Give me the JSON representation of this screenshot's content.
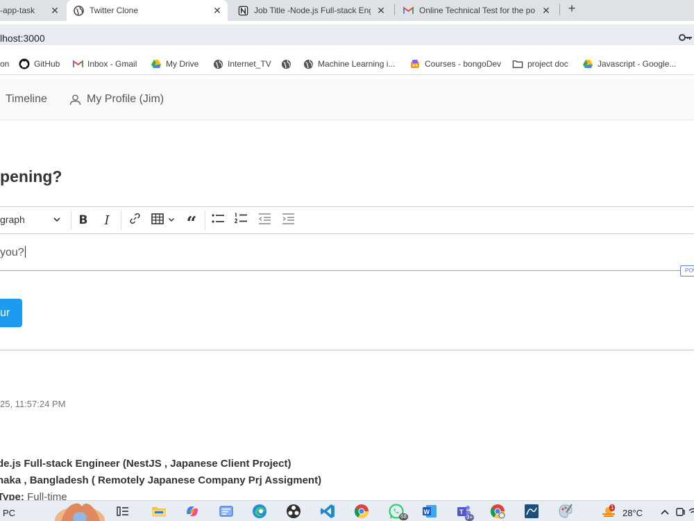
{
  "browser": {
    "tabs": [
      {
        "title": "-app-task",
        "active": false
      },
      {
        "title": "Twitter Clone",
        "active": true
      },
      {
        "title": "Job Title -Node.js Full-stack Eng",
        "active": false
      },
      {
        "title": "Online Technical Test for the po",
        "active": false
      }
    ],
    "url": "lhost:3000"
  },
  "bookmarks": [
    {
      "label": "on",
      "icon": "none"
    },
    {
      "label": "GitHub",
      "icon": "github-icon"
    },
    {
      "label": "Inbox - Gmail",
      "icon": "gmail-icon"
    },
    {
      "label": "My Drive",
      "icon": "drive-icon"
    },
    {
      "label": "Internet_TV",
      "icon": "globe-icon"
    },
    {
      "label": "",
      "icon": "globe-icon"
    },
    {
      "label": "Machine Learning i...",
      "icon": "globe-icon"
    },
    {
      "label": "Courses - bongoDev",
      "icon": "bongodev-icon"
    },
    {
      "label": "project doc",
      "icon": "folder-icon"
    },
    {
      "label": "Javascript - Google...",
      "icon": "drive-icon"
    }
  ],
  "nav": {
    "timeline": "Timeline",
    "profile": "My Profile (Jim)"
  },
  "composer": {
    "heading": "ppening?",
    "heading_style": "graph",
    "text": "you?",
    "powered": "POW",
    "submit": "ur"
  },
  "post": {
    "timestamp": "25, 11:57:24 PM",
    "title": "de.js Full-stack Engineer (NestJS , Japanese Client Project)",
    "location": "haka , Bangladesh ( Remotely Japanese Company Prj Assigment)",
    "type_label": "Type:",
    "type_value": "Full-time"
  },
  "taskbar": {
    "label": "PC",
    "teams_badge": "9+",
    "whatsapp_badge": "68",
    "weather_badge": "1",
    "temperature": "28°C"
  },
  "colors": {
    "accent": "#1d9bf0",
    "editor_focus": "#2977ff",
    "tabstrip": "#dee1e6",
    "taskbar": "#e8ecf3"
  }
}
